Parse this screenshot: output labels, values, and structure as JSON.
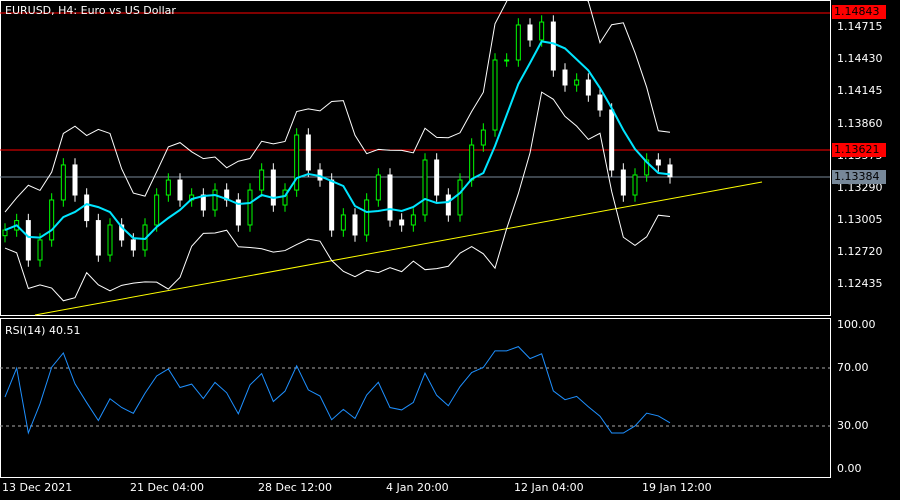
{
  "header": {
    "title": "EURUSD, H4:  Euro vs US Dollar"
  },
  "rsi": {
    "label": "RSI(14) 40.51",
    "levels": [
      "100.00",
      "70.00",
      "30.00",
      "0.00"
    ]
  },
  "price_axis": [
    "1.14715",
    "1.14430",
    "1.14145",
    "1.13860",
    "1.13575",
    "1.13290",
    "1.13005",
    "1.12720",
    "1.12435"
  ],
  "tags": {
    "high": "1.14843",
    "level": "1.13621",
    "bid": "1.13384",
    "high_color": "#ff0000",
    "bid_color": "#778899"
  },
  "time_axis": [
    "13 Dec 2021",
    "21 Dec 04:00",
    "28 Dec 12:00",
    "4 Jan 20:00",
    "12 Jan 04:00",
    "19 Jan 12:00"
  ],
  "colors": {
    "bull": "#00ff00",
    "bear": "#ffffff",
    "ma": "#00e5ff",
    "bands": "#ffffff",
    "trend": "#ffff00",
    "rsi": "#1e90ff"
  },
  "chart_data": {
    "type": "candlestick",
    "symbol": "EURUSD",
    "timeframe": "H4",
    "closes": [
      1.12912,
      1.12996,
      1.12646,
      1.12824,
      1.13179,
      1.1349,
      1.13223,
      1.12996,
      1.1269,
      1.12957,
      1.12824,
      1.12735,
      1.12957,
      1.13223,
      1.13356,
      1.13179,
      1.13223,
      1.1309,
      1.13267,
      1.13179,
      1.12957,
      1.13267,
      1.13445,
      1.13134,
      1.13267,
      1.13756,
      1.13445,
      1.13356,
      1.12912,
      1.13046,
      1.12868,
      1.13179,
      1.13401,
      1.13001,
      1.12957,
      1.13046,
      1.13534,
      1.13223,
      1.13046,
      1.13356,
      1.13667,
      1.138,
      1.14422,
      1.14422,
      1.14733,
      1.146,
      1.14759,
      1.14333,
      1.142,
      1.14244,
      1.14111,
      1.13978,
      1.13445,
      1.13223,
      1.13401,
      1.13534,
      1.1349,
      1.13384
    ],
    "ylim": [
      1.123,
      1.149
    ],
    "rsi_ylim": [
      0,
      100
    ]
  }
}
